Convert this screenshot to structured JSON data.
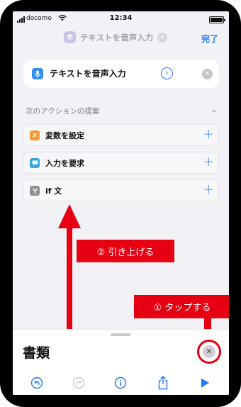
{
  "status_bar": {
    "carrier": "docomo",
    "time": "12:34"
  },
  "nav": {
    "title": "テキストを音声入力",
    "done_label": "完了"
  },
  "action_card": {
    "label": "テキストを音声入力"
  },
  "suggestions": {
    "header": "次のアクションの提案",
    "items": [
      {
        "label": "変数を設定",
        "icon": "x-variable-icon",
        "color": "#f09a37"
      },
      {
        "label": "入力を要求",
        "icon": "speech-bubble-icon",
        "color": "#36a9d8"
      },
      {
        "label": "if 文",
        "icon": "branch-icon",
        "color": "#8e8e93"
      }
    ]
  },
  "annotations": {
    "step2": "② 引き上げる",
    "step1": "① タップする",
    "highlight_color": "#e60012"
  },
  "sheet": {
    "title": "書類"
  },
  "toolbar": {
    "items": [
      "undo-icon",
      "redo-icon",
      "info-icon",
      "share-icon",
      "play-icon"
    ]
  },
  "colors": {
    "accent": "#2479f6",
    "background": "#f2f2f6"
  }
}
